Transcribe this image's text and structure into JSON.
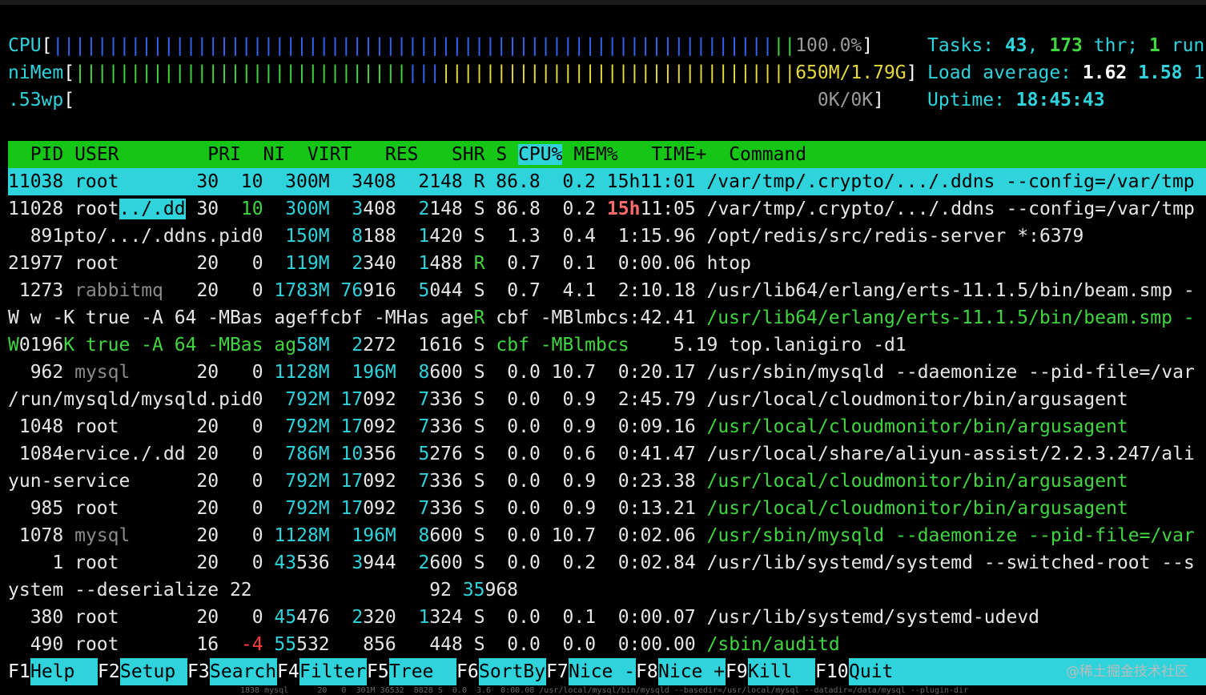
{
  "meters": {
    "cpu": {
      "label": "CPU",
      "value": "100.0%"
    },
    "mem": {
      "label": "niMem",
      "value": "650M/1.79G"
    },
    "swap": {
      "label": ".53wp",
      "value": "0K/0K"
    }
  },
  "summary": {
    "tasks_label": "Tasks:",
    "tasks_count": "43",
    "thr_count": "173",
    "thr_label": "thr;",
    "running_count": "1",
    "running_label": "run",
    "load_label": "Load average:",
    "load1": "1.62",
    "load2": "1.58",
    "load3": "1",
    "uptime_label": "Uptime:",
    "uptime": "18:45:43"
  },
  "columns": {
    "pid": "  PID",
    "user": "USER      ",
    "pri": "  PRI",
    "ni": "  NI",
    "virt": "  VIRT",
    "res": "   RES",
    "shr": "   SHR",
    "s": " S",
    "cpu": "CPU%",
    "mem": " MEM%",
    "time": "   TIME+",
    "command": "  Command"
  },
  "rows": [
    {
      "text": "11038 root       30  10  300M  3408  2148 R 86.8  0.2 15h11:01 /var/tmp/.crypto/.../.ddns --config=/var/tmp"
    },
    {
      "pid": "11028",
      "user": "root",
      "user_extra": "../.dd",
      "pri": "30",
      "ni": "10",
      "virt": "300M",
      "res_a": "3",
      "res_b": "408",
      "shr_a": "2",
      "shr_b": "148",
      "s": "S",
      "cpu": "86.8",
      "mem": "0.2",
      "time_a": "15h",
      "time_b": "11:05",
      "command": "/var/tmp/.crypto/.../.ddns --config=/var/tmp"
    },
    {
      "lead": "  891pto/.../.ddns.pid0",
      "virt": "150M",
      "res_a": "8",
      "res_b": "188",
      "shr_a": "1",
      "shr_b": "420",
      "s": "S",
      "cpu": "1.3",
      "mem": "0.4",
      "time": "1:15.96",
      "command": "/opt/redis/src/redis-server *:6379"
    },
    {
      "pid": "21977",
      "user": "root",
      "pri": "20",
      "ni": "0",
      "virt": "119M",
      "res_a": "2",
      "res_b": "340",
      "shr_a": "1",
      "shr_b": "488",
      "s": "R",
      "cpu": "0.7",
      "mem": "0.1",
      "time": "0:00.06",
      "command": "htop"
    },
    {
      "pid": " 1273",
      "user": "rabbitmq",
      "pri": "20",
      "ni": "0",
      "virt": "1783M",
      "res_a": "76",
      "res_b": "916",
      "shr_a": "5",
      "shr_b": "044",
      "s": "S",
      "cpu": "0.7",
      "mem": "4.1",
      "time": "2:10.18",
      "command": "/usr/lib64/erlang/erts-11.1.5/bin/beam.smp -"
    },
    {
      "lead": "W w -K true -A 64 -MBas ageffcbf -MHas age",
      "s": "R",
      "mid": " cbf -MBlmbcs:42.41",
      "command": "/usr/lib64/erlang/erts-11.1.5/bin/beam.smp -"
    },
    {
      "a": "W",
      "b": "0196",
      "c": "K true -A 64 -MBas ag",
      "virt": "58M",
      "res_a": "2",
      "res_b": "272",
      "shr": "1616",
      "s": "S",
      "mid": "cbf -MBlmbcs",
      "time": "5.19",
      "command": "top.lanigiro -d1"
    },
    {
      "pid": "  962",
      "user": "mysql",
      "pri": "20",
      "ni": "0",
      "virt": "1128M",
      "res": "196M",
      "shr_a": "8",
      "shr_b": "600",
      "s": "S",
      "cpu": "0.0",
      "mem": "10.7",
      "time": "0:20.17",
      "command": "/usr/sbin/mysqld --daemonize --pid-file=/var"
    },
    {
      "lead": "/run/mysqld/mysqld.pid0",
      "virt": "792M",
      "res_a": "17",
      "res_b": "092",
      "shr_a": "7",
      "shr_b": "336",
      "s": "S",
      "cpu": "0.0",
      "mem": "0.9",
      "time": "2:45.79",
      "command": "/usr/local/cloudmonitor/bin/argusagent"
    },
    {
      "pid": " 1048",
      "user": "root",
      "pri": "20",
      "ni": "0",
      "virt": "792M",
      "res_a": "17",
      "res_b": "092",
      "shr_a": "7",
      "shr_b": "336",
      "s": "S",
      "cpu": "0.0",
      "mem": "0.9",
      "time": "0:09.16",
      "command": "/usr/local/cloudmonitor/bin/argusagent"
    },
    {
      "lead": " 1084ervice./.dd",
      "pri": "20",
      "ni": "0",
      "virt": "786M",
      "res_a": "10",
      "res_b": "356",
      "shr_a": "5",
      "shr_b": "276",
      "s": "S",
      "cpu": "0.0",
      "mem": "0.6",
      "time": "0:41.47",
      "command": "/usr/local/share/aliyun-assist/2.2.3.247/ali"
    },
    {
      "lead": "yun-service",
      "pri": "20",
      "ni": "0",
      "virt": "792M",
      "res_a": "17",
      "res_b": "092",
      "shr_a": "7",
      "shr_b": "336",
      "s": "S",
      "cpu": "0.0",
      "mem": "0.9",
      "time": "0:23.38",
      "command": "/usr/local/cloudmonitor/bin/argusagent"
    },
    {
      "pid": "  985",
      "user": "root",
      "pri": "20",
      "ni": "0",
      "virt": "792M",
      "res_a": "17",
      "res_b": "092",
      "shr_a": "7",
      "shr_b": "336",
      "s": "S",
      "cpu": "0.0",
      "mem": "0.9",
      "time": "0:13.21",
      "command": "/usr/local/cloudmonitor/bin/argusagent"
    },
    {
      "pid": " 1078",
      "user": "mysql",
      "pri": "20",
      "ni": "0",
      "virt": "1128M",
      "res": "196M",
      "shr_a": "8",
      "shr_b": "600",
      "s": "S",
      "cpu": "0.0",
      "mem": "10.7",
      "time": "0:02.06",
      "command": "/usr/sbin/mysqld --daemonize --pid-file=/var"
    },
    {
      "pid": "    1",
      "user": "root",
      "pri": "20",
      "ni": "0",
      "virt_a": "43",
      "virt_b": "536",
      "res_a": "3",
      "res_b": "944",
      "shr_a": "2",
      "shr_b": "600",
      "s": "S",
      "cpu": "0.0",
      "mem": "0.2",
      "time": "0:02.84",
      "command": "/usr/lib/systemd/systemd --switched-root --s"
    },
    {
      "lead": "ystem --deserialize 22",
      "res": "92",
      "shr_a": "35",
      "shr_b": "968"
    },
    {
      "pid": "  380",
      "user": "root",
      "pri": "20",
      "ni": "0",
      "virt_a": "45",
      "virt_b": "476",
      "res_a": "2",
      "res_b": "320",
      "shr_a": "1",
      "shr_b": "324",
      "s": "S",
      "cpu": "0.0",
      "mem": "0.1",
      "time": "0:00.07",
      "command": "/usr/lib/systemd/systemd-udevd"
    },
    {
      "pid": "  490",
      "user": "root",
      "pri": "16",
      "ni": "-4",
      "virt_a": "55",
      "virt_b": "532",
      "res": "856",
      "shr": "448",
      "s": "S",
      "cpu": "0.0",
      "mem": "0.0",
      "time": "0:00.00",
      "command": "/sbin/auditd"
    }
  ],
  "footer": [
    {
      "key": "F1",
      "label": "Help  "
    },
    {
      "key": "F2",
      "label": "Setup "
    },
    {
      "key": "F3",
      "label": "Search"
    },
    {
      "key": "F4",
      "label": "Filter"
    },
    {
      "key": "F5",
      "label": "Tree  "
    },
    {
      "key": "F6",
      "label": "SortBy"
    },
    {
      "key": "F7",
      "label": "Nice -"
    },
    {
      "key": "F8",
      "label": "Nice +"
    },
    {
      "key": "F9",
      "label": "Kill  "
    },
    {
      "key": "F10",
      "label": "Quit  "
    }
  ],
  "watermark": "@稀土掘金技术社区",
  "ghost_line": "1838 mysql      20   0  301M 36532  8828 S  0.0  3.6  0:00.08 /usr/local/mysql/bin/mysqld --basedir=/usr/local/mysql --datadir=/data/mysql --plugin-dir"
}
